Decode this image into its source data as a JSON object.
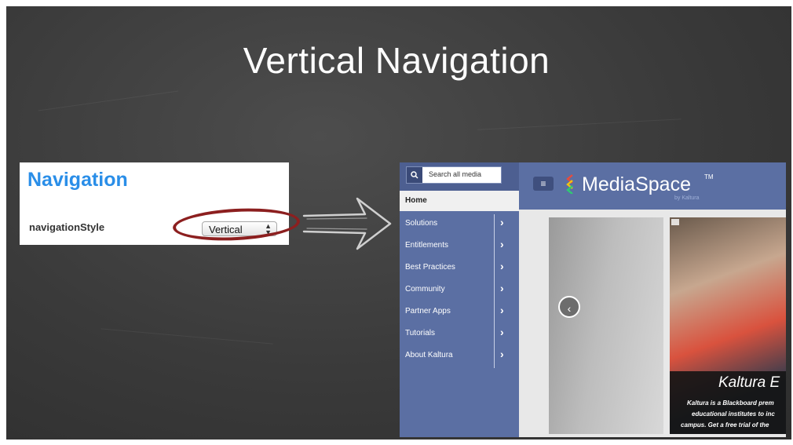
{
  "slide": {
    "title": "Vertical  Navigation"
  },
  "settings_panel": {
    "heading": "Navigation",
    "setting_name": "navigationStyle",
    "select_value": "Vertical",
    "select_arrows": "▲▼"
  },
  "mediaspace": {
    "search_placeholder": "Search all media",
    "nav": {
      "home": "Home",
      "items": [
        {
          "label": "Solutions"
        },
        {
          "label": "Entitlements"
        },
        {
          "label": "Best Practices"
        },
        {
          "label": "Community"
        },
        {
          "label": "Partner Apps"
        },
        {
          "label": "Tutorials"
        },
        {
          "label": "About Kaltura"
        }
      ]
    },
    "header": {
      "logo_text": "MediaSpace",
      "tm": "TM",
      "byline": "by Kaltura"
    },
    "carousel": {
      "caption_title": "Kaltura E",
      "caption_lines": [
        "Kaltura is a Blackboard prem",
        "educational institutes to inc",
        "campus. Get a free trial of the"
      ]
    },
    "colors": {
      "sidebar": "#5b6fa3",
      "header": "#5b6fa3",
      "accent_heading": "#2a8ee8",
      "annotation_circle": "#8c1f1f"
    }
  }
}
